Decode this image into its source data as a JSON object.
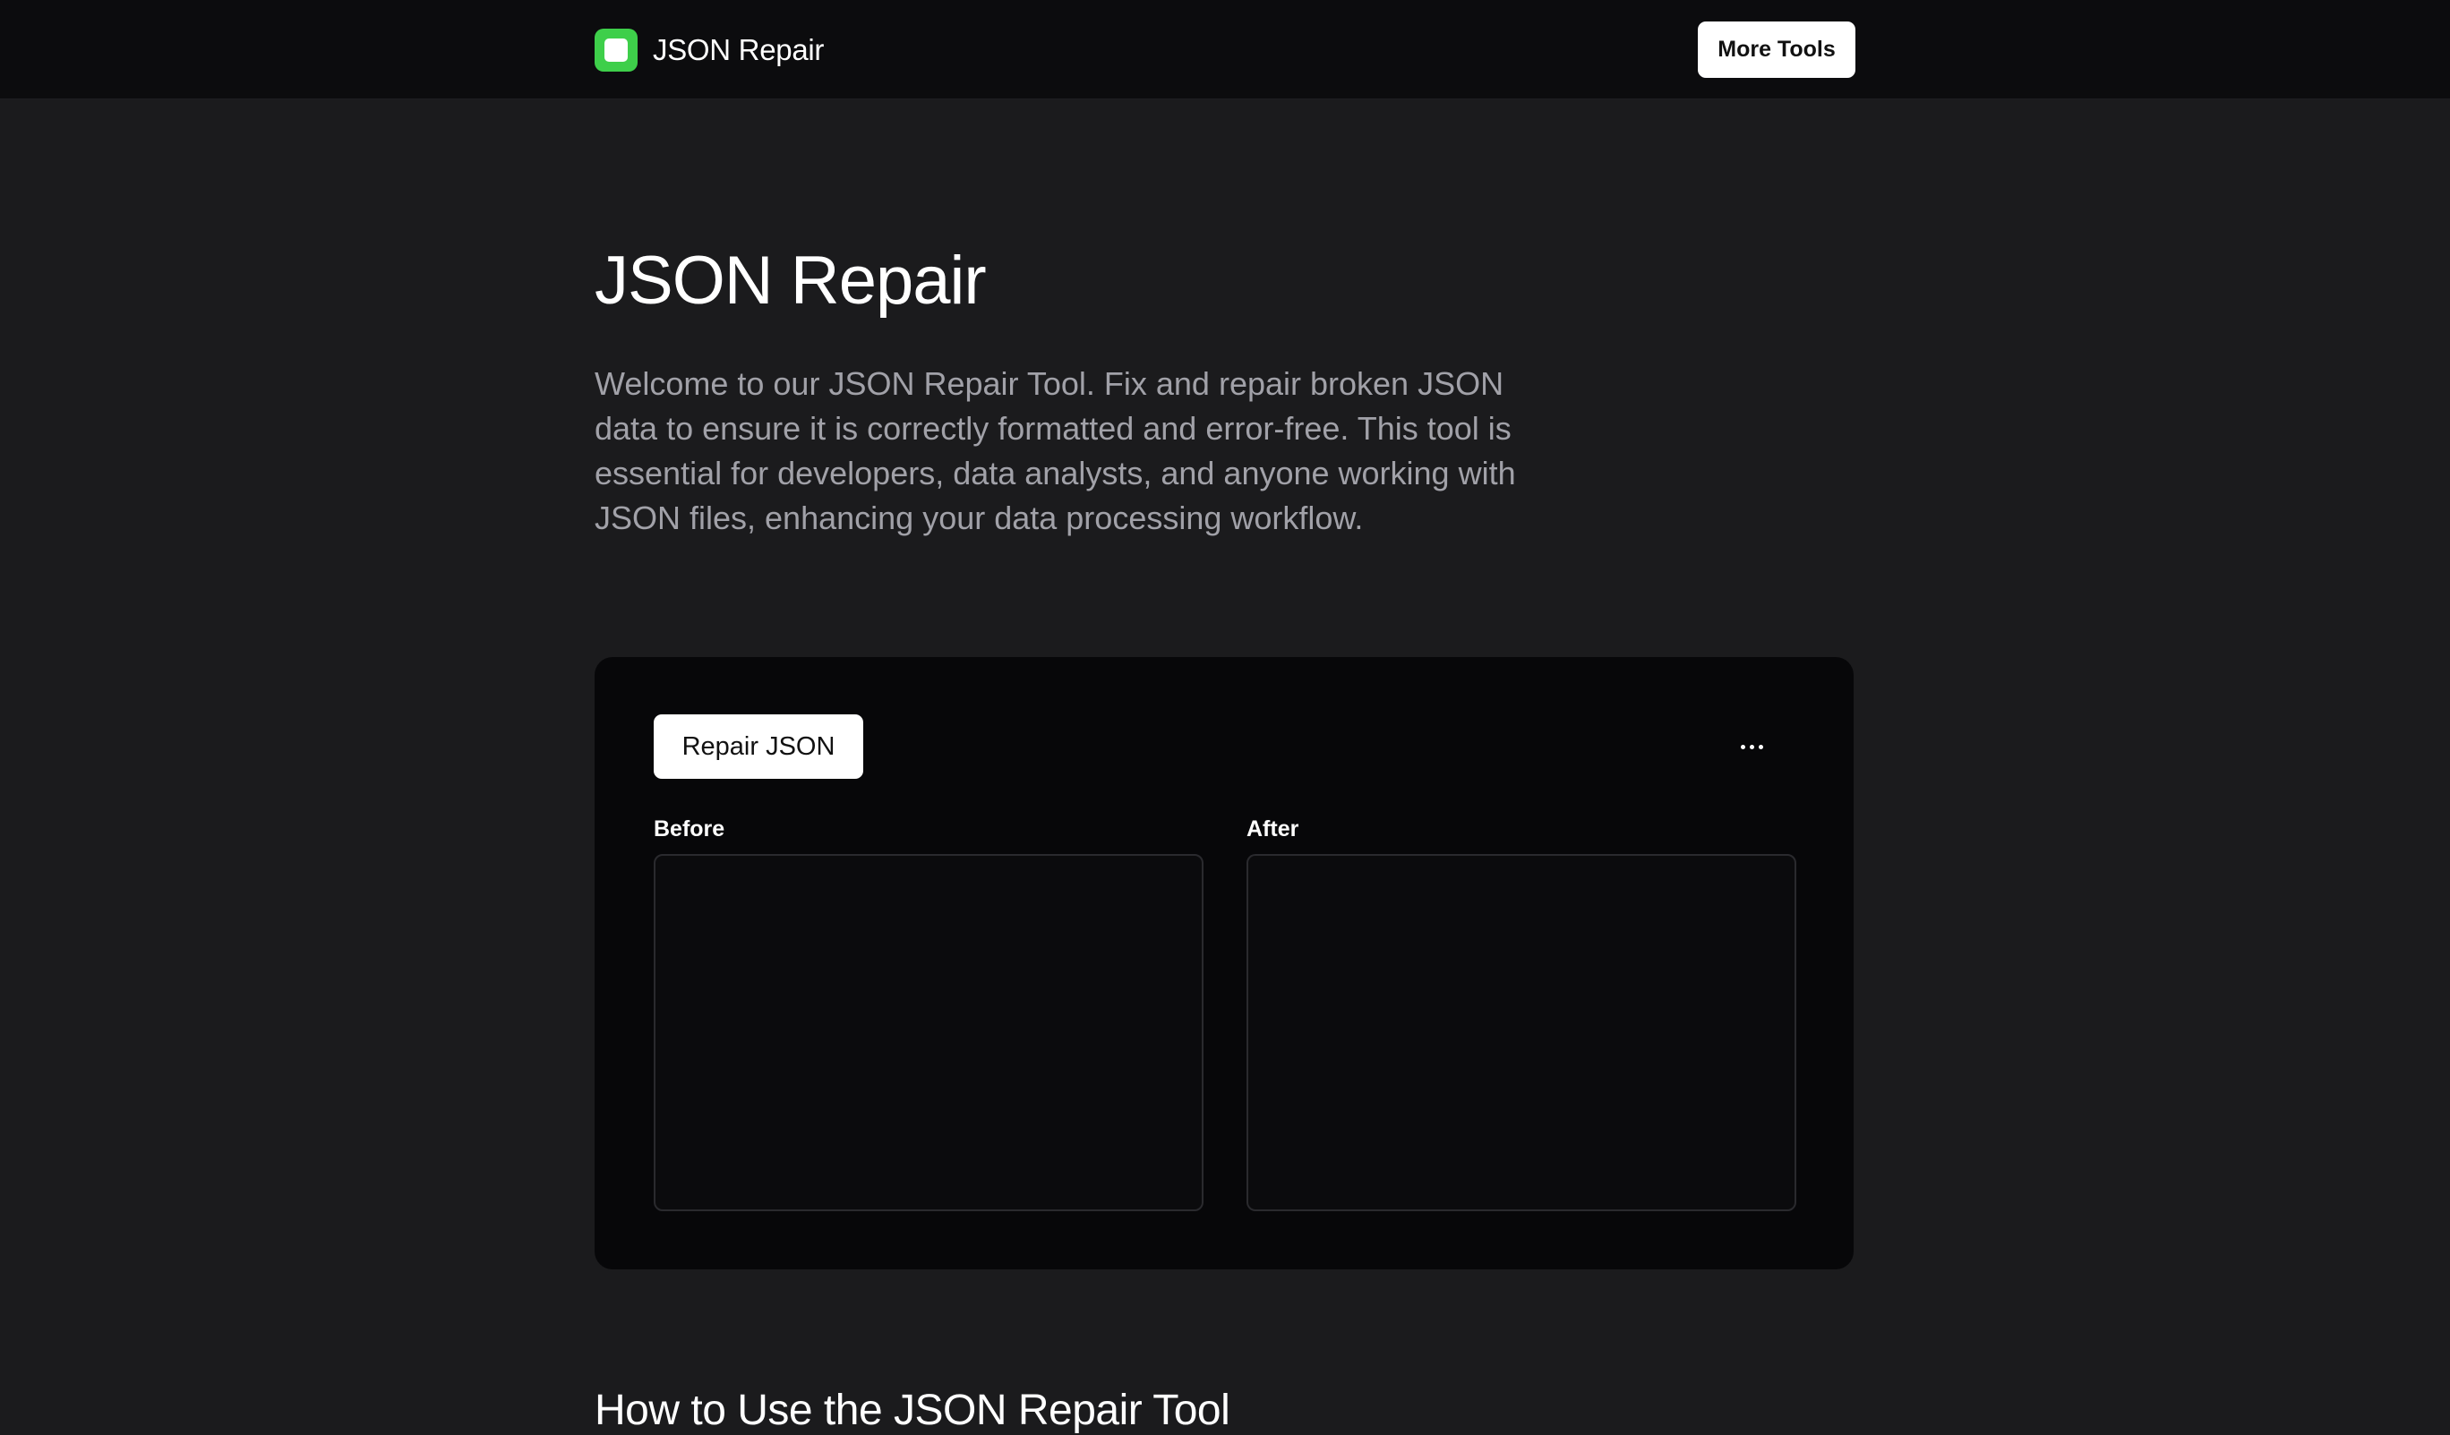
{
  "header": {
    "brand_name": "JSON Repair",
    "more_tools_label": "More Tools",
    "logo_color": "#3ecf4a"
  },
  "hero": {
    "title": "JSON Repair",
    "description": "Welcome to our JSON Repair Tool. Fix and repair broken JSON data to ensure it is correctly formatted and error-free. This tool is essential for developers, data analysts, and anyone working with JSON files, enhancing your data processing workflow."
  },
  "tool": {
    "repair_button_label": "Repair JSON",
    "more_options_icon": "ellipsis-icon",
    "before": {
      "label": "Before",
      "value": ""
    },
    "after": {
      "label": "After",
      "value": ""
    }
  },
  "section": {
    "heading": "How to Use the JSON Repair Tool"
  }
}
